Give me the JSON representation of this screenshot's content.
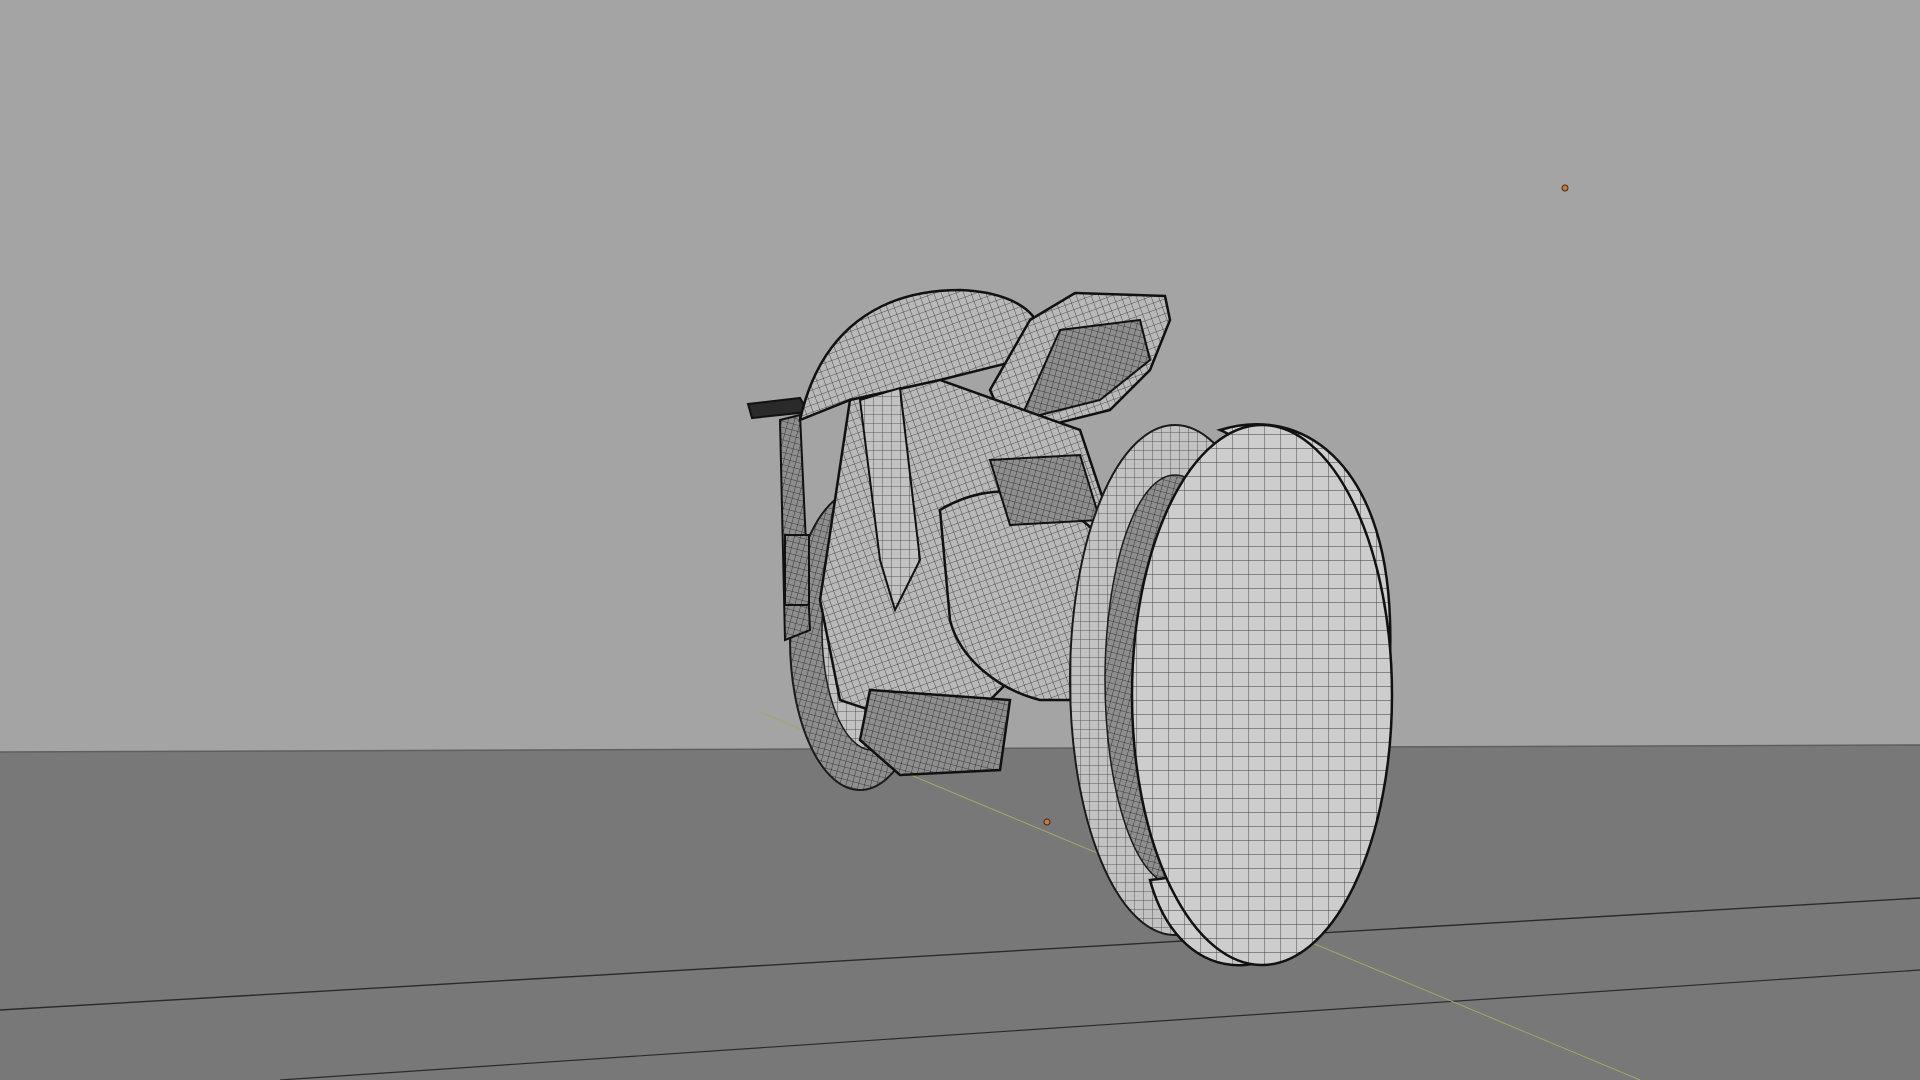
{
  "viewport": {
    "shading_mode": "wireframe-on-solid",
    "background_color": "#a3a3a3",
    "floor_color": "#787878"
  },
  "scene": {
    "objects": [
      {
        "name": "motorcycle-body",
        "type": "mesh"
      },
      {
        "name": "rear-wheel",
        "type": "mesh"
      },
      {
        "name": "front-wheel",
        "type": "mesh"
      },
      {
        "name": "floor-plane",
        "type": "mesh"
      },
      {
        "name": "backdrop-wall",
        "type": "mesh"
      }
    ],
    "lights": [
      {
        "name": "light-point-1",
        "color": "#c87a3a"
      },
      {
        "name": "light-point-2",
        "color": "#c87a3a"
      }
    ],
    "axis_colors": {
      "x": "#d8a8a0",
      "y": "#9ea86a"
    }
  }
}
